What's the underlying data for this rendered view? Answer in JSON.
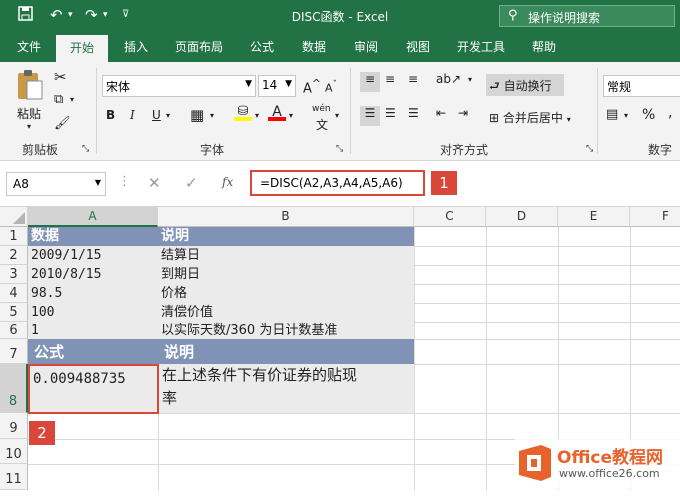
{
  "window": {
    "title": "DISC函数 - Excel",
    "search_placeholder": "操作说明搜索"
  },
  "qat": {
    "save_icon": "save-icon",
    "undo_icon": "undo-icon",
    "redo_icon": "redo-icon"
  },
  "tabs": [
    {
      "label": "文件"
    },
    {
      "label": "开始"
    },
    {
      "label": "插入"
    },
    {
      "label": "页面布局"
    },
    {
      "label": "公式"
    },
    {
      "label": "数据"
    },
    {
      "label": "审阅"
    },
    {
      "label": "视图"
    },
    {
      "label": "开发工具"
    },
    {
      "label": "帮助"
    }
  ],
  "ribbon": {
    "clipboard": {
      "paste_label": "粘贴",
      "group_label": "剪贴板"
    },
    "font": {
      "font_name": "宋体",
      "font_size": "14",
      "bold": "B",
      "italic": "I",
      "underline": "U",
      "grow": "A",
      "shrink": "A",
      "wen": "wén",
      "fill_color": "#ffff00",
      "font_color": "#ff0000",
      "group_label": "字体"
    },
    "alignment": {
      "wrap_label": "自动换行",
      "merge_label": "合并后居中",
      "group_label": "对齐方式"
    },
    "number": {
      "format": "常规",
      "percent": "%",
      "comma": ",",
      "group_label": "数字"
    }
  },
  "formula_bar": {
    "name_box": "A8",
    "fx": "fx",
    "formula": "=DISC(A2,A3,A4,A5,A6)"
  },
  "badges": {
    "one": "1",
    "two": "2"
  },
  "sheet": {
    "columns": [
      "A",
      "B",
      "C",
      "D",
      "E",
      "F"
    ],
    "rows": [
      "1",
      "2",
      "3",
      "4",
      "5",
      "6",
      "7",
      "8",
      "9",
      "10",
      "11"
    ],
    "cells": {
      "A1": "数据",
      "B1": "说明",
      "A2": "2009/1/15",
      "B2": "结算日",
      "A3": "2010/8/15",
      "B3": "到期日",
      "A4": "98.5",
      "B4": "价格",
      "A5": "100",
      "B5": "清偿价值",
      "A6": "1",
      "B6": "以实际天数/360 为日计数基准",
      "A7": "公式",
      "B7": "说明",
      "A8": "0.009488735",
      "B8_line1": "在上述条件下有价证券的贴现",
      "B8_line2": "率"
    },
    "header_band_color": "#8093b7"
  },
  "watermark": {
    "brand": "Office教程网",
    "url": "www.office26.com"
  }
}
